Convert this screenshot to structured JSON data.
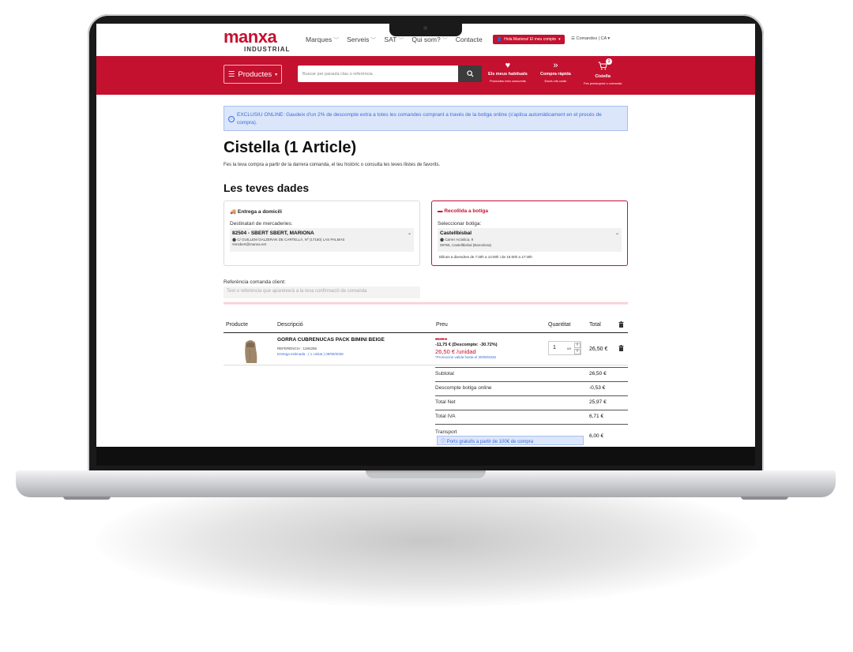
{
  "topbar": {
    "logo_main": "manxa",
    "logo_sub": "INDUSTRIAL",
    "nav": [
      {
        "label": "Marques"
      },
      {
        "label": "Serveis"
      },
      {
        "label": "SAT"
      },
      {
        "label": "Qui som?"
      },
      {
        "label": "Contacte"
      }
    ],
    "account_label": "Hola Mariona! El meu compte",
    "orders_label": "Comandes | CA"
  },
  "header": {
    "products_label": "Productes",
    "search_placeholder": "Buscar per paraula clau o referència",
    "favorites_title": "Els meus habituals",
    "favorites_sub": "Productes més consumits",
    "quick_title": "Compra ràpida",
    "quick_sub": "Escriu els codis",
    "cart_title": "Cistella",
    "cart_sub": "Fes pressupost o comanda",
    "cart_count": "1"
  },
  "alert": {
    "text": "EXCLUSIU ONLINE: Gaudeix d'un 2% de descompte extra a totes les comandes comprant a través de la botiga online (s'aplica automàticament en el procés de compra)."
  },
  "page": {
    "title": "Cistella (1 Article)",
    "subtitle": "Fes la teva compra a partir de la darrera comanda, el teu històric o consulta les teves llistes de favorits.",
    "section_title": "Les teves dades"
  },
  "delivery": {
    "title": "Entrega a domicili",
    "label": "Destinatari de mercaderies:",
    "value": "82504 - SBERT SBERT, MARIONA",
    "address": "C/ GUILLEM GALZERAN DE CARTELLÀ, Nº (17150) LAS PALMAS",
    "email": "msbert@manxa.net"
  },
  "pickup": {
    "title": "Recollida a botiga",
    "label": "Seleccionar botiga:",
    "value": "Castellbisbal",
    "address1": "Carrer Acústica, 9",
    "address2": "08755, Castellbisbal (Barcelona)",
    "hours": "Dilluns a divendres de 7:30h a 14:00h i de 15:00h a 17:30h"
  },
  "reference": {
    "label": "Referència comanda client:",
    "placeholder": "Text o referència que apareixerà a la teva confirmació de comanda"
  },
  "table": {
    "headers": {
      "product": "Producte",
      "description": "Descripció",
      "price": "Preu",
      "quantity": "Quantitat",
      "total": "Total"
    },
    "item": {
      "name": "GORRA CUBRENUCAS PACK BIMINI BEIGE",
      "reference": "REFERENCIA : 1284255",
      "delivery": "Entrega estimada : ( 1 Unitat ) 09/09/2026",
      "price_old": "38,25 €",
      "price_discount": "-11,75 € (Descompte: -30.72%)",
      "price_new": "26,50 € /unidad",
      "promo": "*Promoción valida hasta el 30/09/2026",
      "quantity": "1",
      "unit": "un",
      "total": "26,50 €"
    }
  },
  "summary": [
    {
      "label": "Subtotal",
      "value": "26,50 €"
    },
    {
      "label": "Descompte botiga online",
      "value": "-0,53 €"
    },
    {
      "label": "Total Net",
      "value": "25,97 €"
    },
    {
      "label": "Total IVA",
      "value": "6,71 €"
    }
  ],
  "transport": {
    "label": "Transport",
    "value": "6,00 €",
    "free_shipping": "Ports gratuïts a partir de 100€ de compra"
  },
  "colors": {
    "brand_red": "#c4112f",
    "info_blue": "#3b6bd6",
    "info_bg": "#dbe6fb"
  }
}
